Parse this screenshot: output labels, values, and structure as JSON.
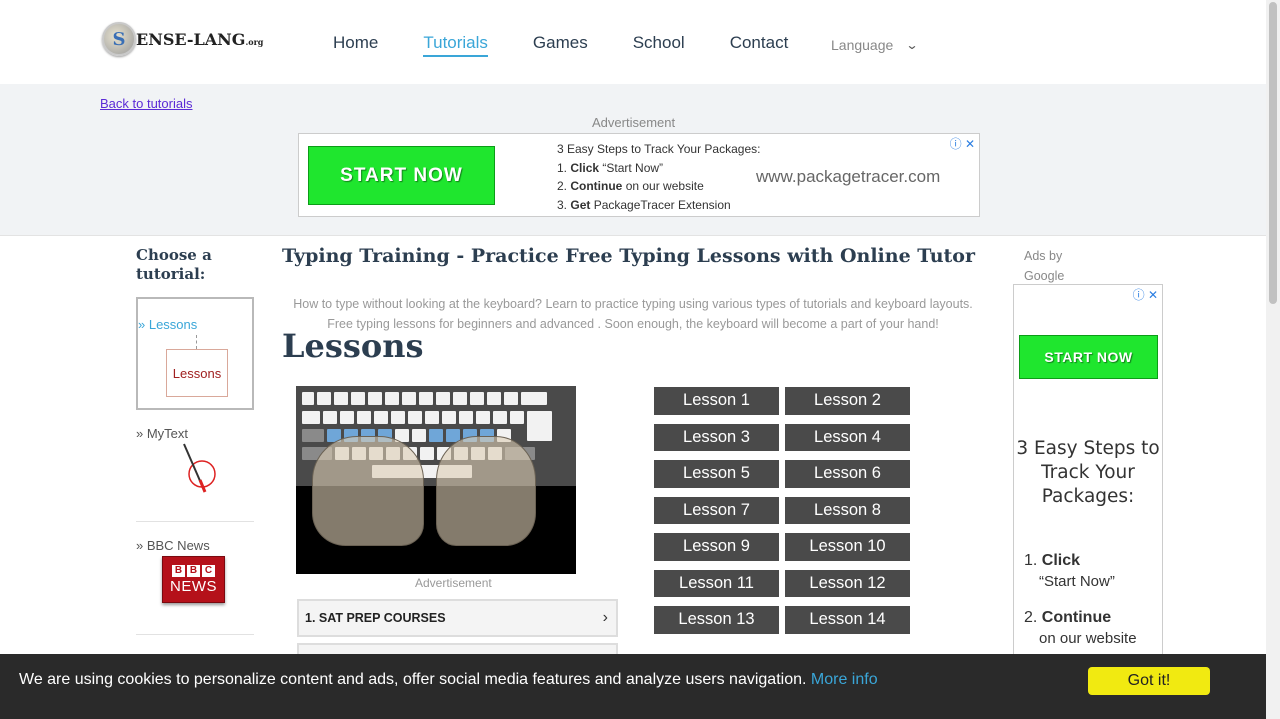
{
  "header": {
    "logo_text": "ENSE-LANG",
    "logo_suffix": ".org",
    "logo_badge": "S",
    "nav": [
      "Home",
      "Tutorials",
      "Games",
      "School",
      "Contact"
    ],
    "active_nav": "Tutorials",
    "language_label": "Language"
  },
  "band": {
    "back_link": "Back to tutorials",
    "ad_label": "Advertisement",
    "ad": {
      "button": "START NOW",
      "steps_title": "3 Easy Steps to Track Your Packages:",
      "steps": [
        {
          "num": "1.",
          "bold": "Click",
          "rest": " “Start Now”"
        },
        {
          "num": "2.",
          "bold": "Continue",
          "rest": " on our website"
        },
        {
          "num": "3.",
          "bold": "Get",
          "rest": " PackageTracer Extension"
        }
      ],
      "url": "www.packagetracer.com",
      "close": "ⓘ ✕"
    }
  },
  "sidebar": {
    "heading": "Choose a tutorial:",
    "items": [
      {
        "label": "» Lessons",
        "image_text": "Lessons"
      },
      {
        "label": "» MyText"
      },
      {
        "label": "» BBC News",
        "image_top": "BBC",
        "image_bottom": "NEWS"
      }
    ]
  },
  "main": {
    "title": "Typing Training - Practice Free Typing Lessons with Online Tutor",
    "intro": "How to type without looking at the keyboard? Learn to practice typing using various types of tutorials and keyboard layouts. Free typing lessons for beginners and advanced . Soon enough, the keyboard will become a part of your hand!",
    "section": "Lessons",
    "ad_label": "Advertisement",
    "sat": "1. SAT PREP COURSES",
    "lessons": [
      "Lesson 1",
      "Lesson 2",
      "Lesson 3",
      "Lesson 4",
      "Lesson 5",
      "Lesson 6",
      "Lesson 7",
      "Lesson 8",
      "Lesson 9",
      "Lesson 10",
      "Lesson 11",
      "Lesson 12",
      "Lesson 13",
      "Lesson 14"
    ]
  },
  "right_ad": {
    "ads_by": "Ads by Google",
    "button": "START NOW",
    "headline": "3 Easy Steps to Track Your Packages:",
    "step1_num": "1.",
    "step1_bold": "Click",
    "step1_sub": "“Start Now”",
    "step2_num": "2.",
    "step2_bold": "Continue",
    "step2_sub": "on our website"
  },
  "cookie": {
    "text": "We are using cookies to personalize content and ads, offer social media features and analyze users navigation.",
    "more": "More info",
    "button": "Got it!"
  },
  "colors": {
    "accent": "#3aa6d8",
    "ad_green": "#1fe62e",
    "lesson_btn": "#4a4a4a",
    "cookie_bg": "#2a2a2a",
    "cookie_btn": "#f1ea11"
  }
}
